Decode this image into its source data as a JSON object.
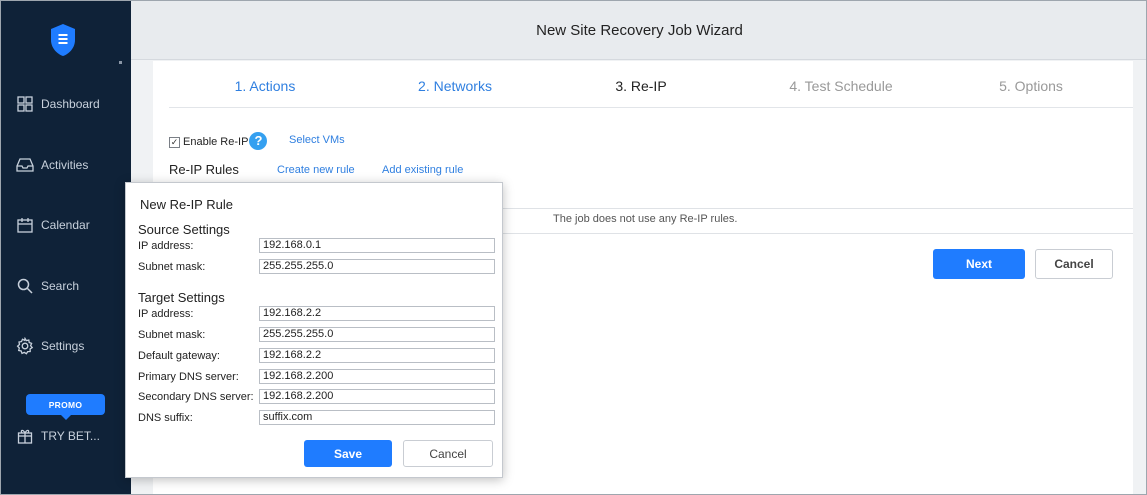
{
  "window": {
    "title": "New Site Recovery Job Wizard"
  },
  "sidebar": {
    "items": [
      {
        "label": "Dashboard",
        "icon": "dashboard-icon"
      },
      {
        "label": "Activities",
        "icon": "activities-icon"
      },
      {
        "label": "Calendar",
        "icon": "calendar-icon"
      },
      {
        "label": "Search",
        "icon": "search-icon"
      },
      {
        "label": "Settings",
        "icon": "settings-icon"
      }
    ],
    "promo_badge": "PROMO",
    "try_beta": "TRY BET..."
  },
  "wizard": {
    "steps": [
      {
        "label": "1. Actions",
        "state": "done"
      },
      {
        "label": "2. Networks",
        "state": "done"
      },
      {
        "label": "3. Re-IP",
        "state": "active"
      },
      {
        "label": "4. Test Schedule",
        "state": "future"
      },
      {
        "label": "5. Options",
        "state": "future"
      }
    ]
  },
  "reip": {
    "enable_label": "Enable Re-IP",
    "enable_checked": true,
    "select_vms": "Select VMs",
    "rules_title": "Re-IP Rules",
    "create_new_rule": "Create new rule",
    "add_existing_rule": "Add existing rule",
    "empty_message": "The job does not use any Re-IP rules."
  },
  "footer": {
    "next_label": "Next",
    "cancel_label": "Cancel"
  },
  "popup": {
    "title": "New Re-IP Rule",
    "source": {
      "heading": "Source Settings",
      "ip_label": "IP address:",
      "ip_value": "192.168.0.1",
      "mask_label": "Subnet mask:",
      "mask_value": "255.255.255.0"
    },
    "target": {
      "heading": "Target Settings",
      "ip_label": "IP address:",
      "ip_value": "192.168.2.2",
      "mask_label": "Subnet mask:",
      "mask_value": "255.255.255.0",
      "gateway_label": "Default gateway:",
      "gateway_value": "192.168.2.2",
      "dns1_label": "Primary DNS server:",
      "dns1_value": "192.168.2.200",
      "dns2_label": "Secondary DNS server:",
      "dns2_value": "192.168.2.200",
      "suffix_label": "DNS suffix:",
      "suffix_value": "suffix.com"
    },
    "save_label": "Save",
    "cancel_label": "Cancel"
  },
  "colors": {
    "sidebar_bg": "#0f2238",
    "accent": "#1f7cff",
    "link": "#2f7fe0",
    "help_icon": "#35a0f0"
  }
}
